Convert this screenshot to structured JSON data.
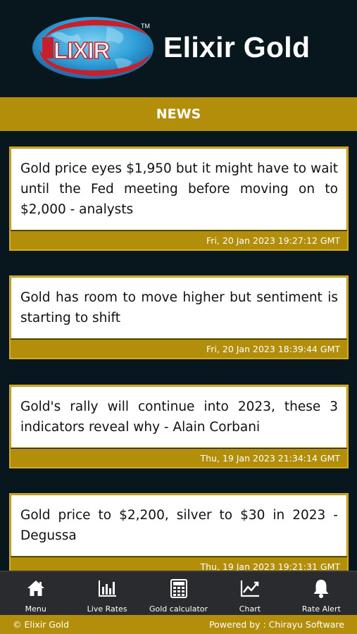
{
  "app": {
    "brand_name": "Elixir Gold",
    "logo_text": "LIXIR",
    "logo_tm": "TM"
  },
  "section": {
    "title": "NEWS"
  },
  "news": [
    {
      "headline": "Gold price eyes $1,950 but it might have to wait until the Fed meeting before moving on to $2,000 - analysts",
      "date": "Fri, 20 Jan 2023 19:27:12 GMT"
    },
    {
      "headline": "Gold has room to move higher but sentiment is starting to shift",
      "date": "Fri, 20 Jan 2023 18:39:44 GMT"
    },
    {
      "headline": "Gold's rally will continue into 2023, these 3 indicators reveal why - Alain Corbani",
      "date": "Thu, 19 Jan 2023 21:34:14 GMT"
    },
    {
      "headline": "Gold price to $2,200, silver to $30 in 2023 - Degussa",
      "date": "Thu, 19 Jan 2023 19:21:31 GMT"
    }
  ],
  "nav": [
    {
      "label": "Menu",
      "icon": "home-icon"
    },
    {
      "label": "Live Rates",
      "icon": "bar-chart-icon"
    },
    {
      "label": "Gold calculator",
      "icon": "calculator-icon"
    },
    {
      "label": "Chart",
      "icon": "line-chart-icon"
    },
    {
      "label": "Rate Alert",
      "icon": "bell-icon"
    }
  ],
  "footer": {
    "copyright": "© Elixir Gold",
    "powered_by": "Powered by : Chirayu Software"
  },
  "colors": {
    "background": "#07171d",
    "accent_gold": "#b38e0b",
    "nav_background": "#2a2b2e"
  }
}
